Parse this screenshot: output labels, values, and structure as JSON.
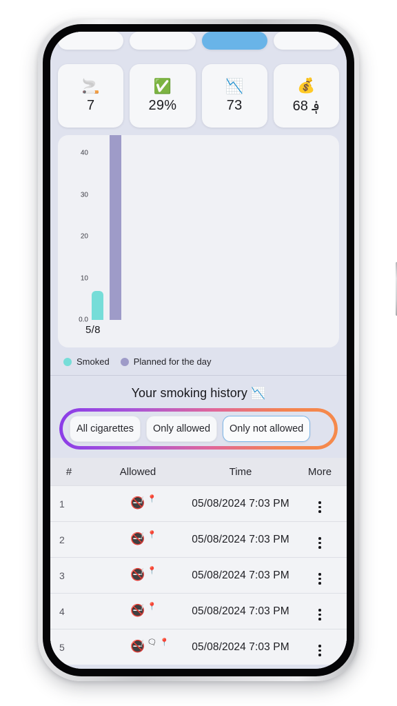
{
  "app": {
    "background_color": "#dfe2ee",
    "card_color": "#f6f7f9"
  },
  "peek_row": {
    "cards": [
      {
        "name": "peek-card-1",
        "accent": false
      },
      {
        "name": "peek-card-2",
        "accent": false
      },
      {
        "name": "peek-card-3",
        "accent": true
      },
      {
        "name": "peek-card-4",
        "accent": false
      }
    ]
  },
  "stats": [
    {
      "icon": "🚬",
      "icon_name": "cigarette-icon",
      "value": "7"
    },
    {
      "icon": "✅",
      "icon_name": "check-mark-icon",
      "value": "29%"
    },
    {
      "icon": "📉",
      "icon_name": "chart-decreasing-icon",
      "value": "73"
    },
    {
      "icon": "💰",
      "icon_name": "money-bag-icon",
      "value": "68 ؋"
    }
  ],
  "chart_data": {
    "type": "bar",
    "title": "",
    "xlabel": "",
    "ylabel": "",
    "categories": [
      "5/8"
    ],
    "series": [
      {
        "name": "Smoked",
        "values": [
          7
        ],
        "color": "#76ddd8"
      },
      {
        "name": "Planned for the day",
        "values": [
          45
        ],
        "color": "#9e9bc8"
      }
    ],
    "ylim": [
      0,
      43
    ],
    "yticks": [
      "0.0",
      "10",
      "20",
      "30",
      "40"
    ],
    "ytick_values": [
      0,
      10,
      20,
      30,
      40
    ],
    "grid": false,
    "legend_position": "below",
    "note": "purple Planned bar is clipped by the top of the plot area"
  },
  "legend": [
    {
      "label": "Smoked",
      "color": "#76ddd8"
    },
    {
      "label": "Planned for the day",
      "color": "#9e9bc8"
    }
  ],
  "history": {
    "title": "Your smoking history",
    "title_emoji": "📉",
    "annotation": {
      "shape": "rounded-rectangle-ring",
      "gradient_from": "#8a3ce8",
      "gradient_to": "#f58a4b"
    },
    "filters": [
      {
        "label": "All cigarettes",
        "selected": false
      },
      {
        "label": "Only allowed",
        "selected": false
      },
      {
        "label": "Only not allowed",
        "selected": true
      }
    ],
    "columns": [
      "#",
      "Allowed",
      "Time",
      "More"
    ],
    "rows": [
      {
        "num": "1",
        "allowed_icon": "🚭",
        "badges": [
          "📍"
        ],
        "time": "05/08/2024 7:03 PM"
      },
      {
        "num": "2",
        "allowed_icon": "🚭",
        "badges": [
          "📍"
        ],
        "time": "05/08/2024 7:03 PM"
      },
      {
        "num": "3",
        "allowed_icon": "🚭",
        "badges": [
          "📍"
        ],
        "time": "05/08/2024 7:03 PM"
      },
      {
        "num": "4",
        "allowed_icon": "🚭",
        "badges": [
          "📍"
        ],
        "time": "05/08/2024 7:03 PM"
      },
      {
        "num": "5",
        "allowed_icon": "🚭",
        "badges": [
          "🗨",
          "📍"
        ],
        "time": "05/08/2024 7:03 PM"
      }
    ]
  }
}
